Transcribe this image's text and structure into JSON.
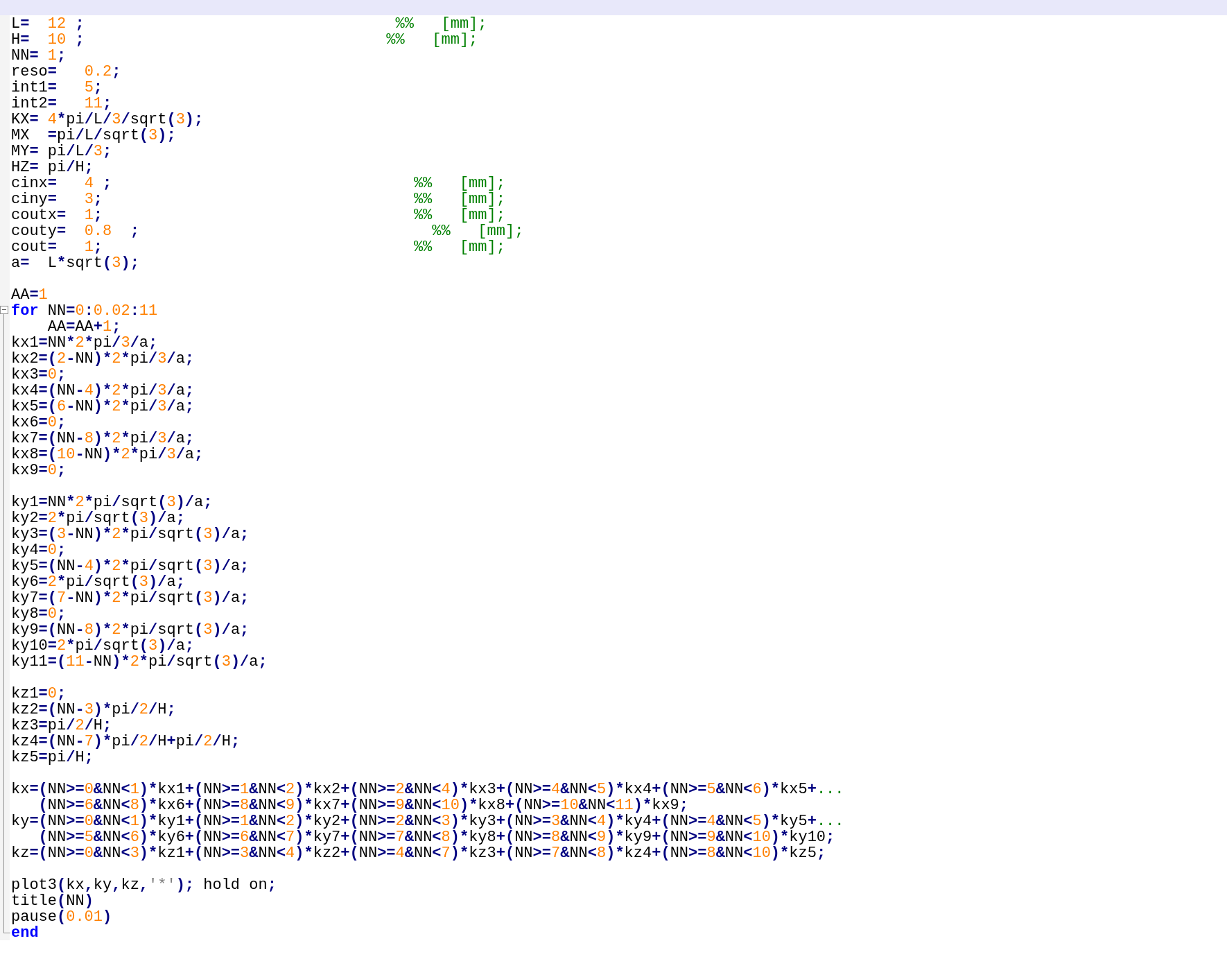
{
  "editor": {
    "lines": [
      {
        "tokens": [
          {
            "kind": "code",
            "text": "L=  "
          },
          {
            "kind": "number",
            "text": "12"
          },
          {
            "kind": "code",
            "text": " ;"
          },
          {
            "kind": "comment",
            "text": "                                  %%   [mm];"
          }
        ]
      },
      {
        "tokens": [
          {
            "kind": "code",
            "text": "H=  "
          },
          {
            "kind": "number",
            "text": "10"
          },
          {
            "kind": "code",
            "text": " ;"
          },
          {
            "kind": "comment",
            "text": "                                 %%   [mm];"
          }
        ]
      },
      {
        "tokens": [
          {
            "kind": "code",
            "text": "NN= "
          },
          {
            "kind": "number",
            "text": "1"
          },
          {
            "kind": "code",
            "text": ";"
          }
        ]
      },
      {
        "tokens": [
          {
            "kind": "code",
            "text": "reso=   "
          },
          {
            "kind": "number",
            "text": "0.2"
          },
          {
            "kind": "code",
            "text": ";"
          }
        ]
      },
      {
        "tokens": [
          {
            "kind": "code",
            "text": "int1=   "
          },
          {
            "kind": "number",
            "text": "5"
          },
          {
            "kind": "code",
            "text": ";"
          }
        ]
      },
      {
        "tokens": [
          {
            "kind": "code",
            "text": "int2=   "
          },
          {
            "kind": "number",
            "text": "11"
          },
          {
            "kind": "code",
            "text": ";"
          }
        ]
      },
      {
        "tokens": [
          {
            "kind": "code",
            "text": "KX= "
          },
          {
            "kind": "number",
            "text": "4"
          },
          {
            "kind": "code",
            "text": "*pi/L/"
          },
          {
            "kind": "number",
            "text": "3"
          },
          {
            "kind": "code",
            "text": "/sqrt("
          },
          {
            "kind": "number",
            "text": "3"
          },
          {
            "kind": "code",
            "text": ");"
          }
        ]
      },
      {
        "tokens": [
          {
            "kind": "code",
            "text": "MX  =pi/L/sqrt("
          },
          {
            "kind": "number",
            "text": "3"
          },
          {
            "kind": "code",
            "text": ");"
          }
        ]
      },
      {
        "tokens": [
          {
            "kind": "code",
            "text": "MY= pi/L/"
          },
          {
            "kind": "number",
            "text": "3"
          },
          {
            "kind": "code",
            "text": ";"
          }
        ]
      },
      {
        "tokens": [
          {
            "kind": "code",
            "text": "HZ= pi/H;"
          }
        ]
      },
      {
        "tokens": [
          {
            "kind": "code",
            "text": "cinx=   "
          },
          {
            "kind": "number",
            "text": "4"
          },
          {
            "kind": "code",
            "text": " ;"
          },
          {
            "kind": "comment",
            "text": "                                 %%   [mm];"
          }
        ]
      },
      {
        "tokens": [
          {
            "kind": "code",
            "text": "ciny=   "
          },
          {
            "kind": "number",
            "text": "3"
          },
          {
            "kind": "code",
            "text": ";"
          },
          {
            "kind": "comment",
            "text": "                                  %%   [mm];"
          }
        ]
      },
      {
        "tokens": [
          {
            "kind": "code",
            "text": "coutx=  "
          },
          {
            "kind": "number",
            "text": "1"
          },
          {
            "kind": "code",
            "text": ";"
          },
          {
            "kind": "comment",
            "text": "                                  %%   [mm];"
          }
        ]
      },
      {
        "tokens": [
          {
            "kind": "code",
            "text": "couty=  "
          },
          {
            "kind": "number",
            "text": "0.8"
          },
          {
            "kind": "code",
            "text": "  ;"
          },
          {
            "kind": "comment",
            "text": "                                %%   [mm];"
          }
        ]
      },
      {
        "tokens": [
          {
            "kind": "code",
            "text": "cout=   "
          },
          {
            "kind": "number",
            "text": "1"
          },
          {
            "kind": "code",
            "text": ";"
          },
          {
            "kind": "comment",
            "text": "                                  %%   [mm];"
          }
        ]
      },
      {
        "tokens": [
          {
            "kind": "code",
            "text": "a=  L*sqrt("
          },
          {
            "kind": "number",
            "text": "3"
          },
          {
            "kind": "code",
            "text": ");"
          }
        ]
      },
      {
        "kind": "blank"
      },
      {
        "tokens": [
          {
            "kind": "code",
            "text": "AA="
          },
          {
            "kind": "number",
            "text": "1"
          }
        ]
      },
      {
        "kind": "fold_start",
        "tokens": [
          {
            "kind": "keyword",
            "text": "for"
          },
          {
            "kind": "code",
            "text": " NN="
          },
          {
            "kind": "number",
            "text": "0"
          },
          {
            "kind": "code",
            "text": ":"
          },
          {
            "kind": "number",
            "text": "0.02"
          },
          {
            "kind": "code",
            "text": ":"
          },
          {
            "kind": "number",
            "text": "11"
          }
        ]
      },
      {
        "tokens": [
          {
            "kind": "code",
            "text": "    AA=AA+"
          },
          {
            "kind": "number",
            "text": "1"
          },
          {
            "kind": "code",
            "text": ";"
          }
        ]
      },
      {
        "tokens": [
          {
            "kind": "code",
            "text": "kx1=NN*"
          },
          {
            "kind": "number",
            "text": "2"
          },
          {
            "kind": "code",
            "text": "*pi/"
          },
          {
            "kind": "number",
            "text": "3"
          },
          {
            "kind": "code",
            "text": "/a;"
          }
        ]
      },
      {
        "tokens": [
          {
            "kind": "code",
            "text": "kx2=("
          },
          {
            "kind": "number",
            "text": "2"
          },
          {
            "kind": "code",
            "text": "-NN)*"
          },
          {
            "kind": "number",
            "text": "2"
          },
          {
            "kind": "code",
            "text": "*pi/"
          },
          {
            "kind": "number",
            "text": "3"
          },
          {
            "kind": "code",
            "text": "/a;"
          }
        ]
      },
      {
        "tokens": [
          {
            "kind": "code",
            "text": "kx3="
          },
          {
            "kind": "number",
            "text": "0"
          },
          {
            "kind": "code",
            "text": ";"
          }
        ]
      },
      {
        "tokens": [
          {
            "kind": "code",
            "text": "kx4=(NN-"
          },
          {
            "kind": "number",
            "text": "4"
          },
          {
            "kind": "code",
            "text": ")*"
          },
          {
            "kind": "number",
            "text": "2"
          },
          {
            "kind": "code",
            "text": "*pi/"
          },
          {
            "kind": "number",
            "text": "3"
          },
          {
            "kind": "code",
            "text": "/a;"
          }
        ]
      },
      {
        "tokens": [
          {
            "kind": "code",
            "text": "kx5=("
          },
          {
            "kind": "number",
            "text": "6"
          },
          {
            "kind": "code",
            "text": "-NN)*"
          },
          {
            "kind": "number",
            "text": "2"
          },
          {
            "kind": "code",
            "text": "*pi/"
          },
          {
            "kind": "number",
            "text": "3"
          },
          {
            "kind": "code",
            "text": "/a;"
          }
        ]
      },
      {
        "tokens": [
          {
            "kind": "code",
            "text": "kx6="
          },
          {
            "kind": "number",
            "text": "0"
          },
          {
            "kind": "code",
            "text": ";"
          }
        ]
      },
      {
        "tokens": [
          {
            "kind": "code",
            "text": "kx7=(NN-"
          },
          {
            "kind": "number",
            "text": "8"
          },
          {
            "kind": "code",
            "text": ")*"
          },
          {
            "kind": "number",
            "text": "2"
          },
          {
            "kind": "code",
            "text": "*pi/"
          },
          {
            "kind": "number",
            "text": "3"
          },
          {
            "kind": "code",
            "text": "/a;"
          }
        ]
      },
      {
        "tokens": [
          {
            "kind": "code",
            "text": "kx8=("
          },
          {
            "kind": "number",
            "text": "10"
          },
          {
            "kind": "code",
            "text": "-NN)*"
          },
          {
            "kind": "number",
            "text": "2"
          },
          {
            "kind": "code",
            "text": "*pi/"
          },
          {
            "kind": "number",
            "text": "3"
          },
          {
            "kind": "code",
            "text": "/a;"
          }
        ]
      },
      {
        "tokens": [
          {
            "kind": "code",
            "text": "kx9="
          },
          {
            "kind": "number",
            "text": "0"
          },
          {
            "kind": "code",
            "text": ";"
          }
        ]
      },
      {
        "kind": "blank"
      },
      {
        "tokens": [
          {
            "kind": "code",
            "text": "ky1=NN*"
          },
          {
            "kind": "number",
            "text": "2"
          },
          {
            "kind": "code",
            "text": "*pi/sqrt("
          },
          {
            "kind": "number",
            "text": "3"
          },
          {
            "kind": "code",
            "text": ")/a;"
          }
        ]
      },
      {
        "tokens": [
          {
            "kind": "code",
            "text": "ky2="
          },
          {
            "kind": "number",
            "text": "2"
          },
          {
            "kind": "code",
            "text": "*pi/sqrt("
          },
          {
            "kind": "number",
            "text": "3"
          },
          {
            "kind": "code",
            "text": ")/a;"
          }
        ]
      },
      {
        "tokens": [
          {
            "kind": "code",
            "text": "ky3=("
          },
          {
            "kind": "number",
            "text": "3"
          },
          {
            "kind": "code",
            "text": "-NN)*"
          },
          {
            "kind": "number",
            "text": "2"
          },
          {
            "kind": "code",
            "text": "*pi/sqrt("
          },
          {
            "kind": "number",
            "text": "3"
          },
          {
            "kind": "code",
            "text": ")/a;"
          }
        ]
      },
      {
        "tokens": [
          {
            "kind": "code",
            "text": "ky4="
          },
          {
            "kind": "number",
            "text": "0"
          },
          {
            "kind": "code",
            "text": ";"
          }
        ]
      },
      {
        "tokens": [
          {
            "kind": "code",
            "text": "ky5=(NN-"
          },
          {
            "kind": "number",
            "text": "4"
          },
          {
            "kind": "code",
            "text": ")*"
          },
          {
            "kind": "number",
            "text": "2"
          },
          {
            "kind": "code",
            "text": "*pi/sqrt("
          },
          {
            "kind": "number",
            "text": "3"
          },
          {
            "kind": "code",
            "text": ")/a;"
          }
        ]
      },
      {
        "tokens": [
          {
            "kind": "code",
            "text": "ky6="
          },
          {
            "kind": "number",
            "text": "2"
          },
          {
            "kind": "code",
            "text": "*pi/sqrt("
          },
          {
            "kind": "number",
            "text": "3"
          },
          {
            "kind": "code",
            "text": ")/a;"
          }
        ]
      },
      {
        "tokens": [
          {
            "kind": "code",
            "text": "ky7=("
          },
          {
            "kind": "number",
            "text": "7"
          },
          {
            "kind": "code",
            "text": "-NN)*"
          },
          {
            "kind": "number",
            "text": "2"
          },
          {
            "kind": "code",
            "text": "*pi/sqrt("
          },
          {
            "kind": "number",
            "text": "3"
          },
          {
            "kind": "code",
            "text": ")/a;"
          }
        ]
      },
      {
        "tokens": [
          {
            "kind": "code",
            "text": "ky8="
          },
          {
            "kind": "number",
            "text": "0"
          },
          {
            "kind": "code",
            "text": ";"
          }
        ]
      },
      {
        "tokens": [
          {
            "kind": "code",
            "text": "ky9=(NN-"
          },
          {
            "kind": "number",
            "text": "8"
          },
          {
            "kind": "code",
            "text": ")*"
          },
          {
            "kind": "number",
            "text": "2"
          },
          {
            "kind": "code",
            "text": "*pi/sqrt("
          },
          {
            "kind": "number",
            "text": "3"
          },
          {
            "kind": "code",
            "text": ")/a;"
          }
        ]
      },
      {
        "tokens": [
          {
            "kind": "code",
            "text": "ky10="
          },
          {
            "kind": "number",
            "text": "2"
          },
          {
            "kind": "code",
            "text": "*pi/sqrt("
          },
          {
            "kind": "number",
            "text": "3"
          },
          {
            "kind": "code",
            "text": ")/a;"
          }
        ]
      },
      {
        "tokens": [
          {
            "kind": "code",
            "text": "ky11=("
          },
          {
            "kind": "number",
            "text": "11"
          },
          {
            "kind": "code",
            "text": "-NN)*"
          },
          {
            "kind": "number",
            "text": "2"
          },
          {
            "kind": "code",
            "text": "*pi/sqrt("
          },
          {
            "kind": "number",
            "text": "3"
          },
          {
            "kind": "code",
            "text": ")/a;"
          }
        ]
      },
      {
        "kind": "blank"
      },
      {
        "tokens": [
          {
            "kind": "code",
            "text": "kz1="
          },
          {
            "kind": "number",
            "text": "0"
          },
          {
            "kind": "code",
            "text": ";"
          }
        ]
      },
      {
        "tokens": [
          {
            "kind": "code",
            "text": "kz2=(NN-"
          },
          {
            "kind": "number",
            "text": "3"
          },
          {
            "kind": "code",
            "text": ")*pi/"
          },
          {
            "kind": "number",
            "text": "2"
          },
          {
            "kind": "code",
            "text": "/H;"
          }
        ]
      },
      {
        "tokens": [
          {
            "kind": "code",
            "text": "kz3=pi/"
          },
          {
            "kind": "number",
            "text": "2"
          },
          {
            "kind": "code",
            "text": "/H;"
          }
        ]
      },
      {
        "tokens": [
          {
            "kind": "code",
            "text": "kz4=(NN-"
          },
          {
            "kind": "number",
            "text": "7"
          },
          {
            "kind": "code",
            "text": ")*pi/"
          },
          {
            "kind": "number",
            "text": "2"
          },
          {
            "kind": "code",
            "text": "/H+pi/"
          },
          {
            "kind": "number",
            "text": "2"
          },
          {
            "kind": "code",
            "text": "/H;"
          }
        ]
      },
      {
        "tokens": [
          {
            "kind": "code",
            "text": "kz5=pi/H;"
          }
        ]
      },
      {
        "kind": "blank"
      },
      {
        "tokens": [
          {
            "kind": "code",
            "text": "kx=(NN>="
          },
          {
            "kind": "number",
            "text": "0"
          },
          {
            "kind": "code",
            "text": "&NN<"
          },
          {
            "kind": "number",
            "text": "1"
          },
          {
            "kind": "code",
            "text": ")*kx1+(NN>="
          },
          {
            "kind": "number",
            "text": "1"
          },
          {
            "kind": "code",
            "text": "&NN<"
          },
          {
            "kind": "number",
            "text": "2"
          },
          {
            "kind": "code",
            "text": ")*kx2+(NN>="
          },
          {
            "kind": "number",
            "text": "2"
          },
          {
            "kind": "code",
            "text": "&NN<"
          },
          {
            "kind": "number",
            "text": "4"
          },
          {
            "kind": "code",
            "text": ")*kx3+(NN>="
          },
          {
            "kind": "number",
            "text": "4"
          },
          {
            "kind": "code",
            "text": "&NN<"
          },
          {
            "kind": "number",
            "text": "5"
          },
          {
            "kind": "code",
            "text": ")*kx4+(NN>="
          },
          {
            "kind": "number",
            "text": "5"
          },
          {
            "kind": "code",
            "text": "&NN<"
          },
          {
            "kind": "number",
            "text": "6"
          },
          {
            "kind": "code",
            "text": ")*kx5+"
          },
          {
            "kind": "comment",
            "text": "..."
          }
        ]
      },
      {
        "tokens": [
          {
            "kind": "code",
            "text": "   (NN>="
          },
          {
            "kind": "number",
            "text": "6"
          },
          {
            "kind": "code",
            "text": "&NN<"
          },
          {
            "kind": "number",
            "text": "8"
          },
          {
            "kind": "code",
            "text": ")*kx6+(NN>="
          },
          {
            "kind": "number",
            "text": "8"
          },
          {
            "kind": "code",
            "text": "&NN<"
          },
          {
            "kind": "number",
            "text": "9"
          },
          {
            "kind": "code",
            "text": ")*kx7+(NN>="
          },
          {
            "kind": "number",
            "text": "9"
          },
          {
            "kind": "code",
            "text": "&NN<"
          },
          {
            "kind": "number",
            "text": "10"
          },
          {
            "kind": "code",
            "text": ")*kx8+(NN>="
          },
          {
            "kind": "number",
            "text": "10"
          },
          {
            "kind": "code",
            "text": "&NN<"
          },
          {
            "kind": "number",
            "text": "11"
          },
          {
            "kind": "code",
            "text": ")*kx9;"
          }
        ]
      },
      {
        "tokens": [
          {
            "kind": "code",
            "text": "ky=(NN>="
          },
          {
            "kind": "number",
            "text": "0"
          },
          {
            "kind": "code",
            "text": "&NN<"
          },
          {
            "kind": "number",
            "text": "1"
          },
          {
            "kind": "code",
            "text": ")*ky1+(NN>="
          },
          {
            "kind": "number",
            "text": "1"
          },
          {
            "kind": "code",
            "text": "&NN<"
          },
          {
            "kind": "number",
            "text": "2"
          },
          {
            "kind": "code",
            "text": ")*ky2+(NN>="
          },
          {
            "kind": "number",
            "text": "2"
          },
          {
            "kind": "code",
            "text": "&NN<"
          },
          {
            "kind": "number",
            "text": "3"
          },
          {
            "kind": "code",
            "text": ")*ky3+(NN>="
          },
          {
            "kind": "number",
            "text": "3"
          },
          {
            "kind": "code",
            "text": "&NN<"
          },
          {
            "kind": "number",
            "text": "4"
          },
          {
            "kind": "code",
            "text": ")*ky4+(NN>="
          },
          {
            "kind": "number",
            "text": "4"
          },
          {
            "kind": "code",
            "text": "&NN<"
          },
          {
            "kind": "number",
            "text": "5"
          },
          {
            "kind": "code",
            "text": ")*ky5+"
          },
          {
            "kind": "comment",
            "text": "..."
          }
        ]
      },
      {
        "tokens": [
          {
            "kind": "code",
            "text": "   (NN>="
          },
          {
            "kind": "number",
            "text": "5"
          },
          {
            "kind": "code",
            "text": "&NN<"
          },
          {
            "kind": "number",
            "text": "6"
          },
          {
            "kind": "code",
            "text": ")*ky6+(NN>="
          },
          {
            "kind": "number",
            "text": "6"
          },
          {
            "kind": "code",
            "text": "&NN<"
          },
          {
            "kind": "number",
            "text": "7"
          },
          {
            "kind": "code",
            "text": ")*ky7+(NN>="
          },
          {
            "kind": "number",
            "text": "7"
          },
          {
            "kind": "code",
            "text": "&NN<"
          },
          {
            "kind": "number",
            "text": "8"
          },
          {
            "kind": "code",
            "text": ")*ky8+(NN>="
          },
          {
            "kind": "number",
            "text": "8"
          },
          {
            "kind": "code",
            "text": "&NN<"
          },
          {
            "kind": "number",
            "text": "9"
          },
          {
            "kind": "code",
            "text": ")*ky9+(NN>="
          },
          {
            "kind": "number",
            "text": "9"
          },
          {
            "kind": "code",
            "text": "&NN<"
          },
          {
            "kind": "number",
            "text": "10"
          },
          {
            "kind": "code",
            "text": ")*ky10;"
          }
        ]
      },
      {
        "tokens": [
          {
            "kind": "code",
            "text": "kz=(NN>="
          },
          {
            "kind": "number",
            "text": "0"
          },
          {
            "kind": "code",
            "text": "&NN<"
          },
          {
            "kind": "number",
            "text": "3"
          },
          {
            "kind": "code",
            "text": ")*kz1+(NN>="
          },
          {
            "kind": "number",
            "text": "3"
          },
          {
            "kind": "code",
            "text": "&NN<"
          },
          {
            "kind": "number",
            "text": "4"
          },
          {
            "kind": "code",
            "text": ")*kz2+(NN>="
          },
          {
            "kind": "number",
            "text": "4"
          },
          {
            "kind": "code",
            "text": "&NN<"
          },
          {
            "kind": "number",
            "text": "7"
          },
          {
            "kind": "code",
            "text": ")*kz3+(NN>="
          },
          {
            "kind": "number",
            "text": "7"
          },
          {
            "kind": "code",
            "text": "&NN<"
          },
          {
            "kind": "number",
            "text": "8"
          },
          {
            "kind": "code",
            "text": ")*kz4+(NN>="
          },
          {
            "kind": "number",
            "text": "8"
          },
          {
            "kind": "code",
            "text": "&NN<"
          },
          {
            "kind": "number",
            "text": "10"
          },
          {
            "kind": "code",
            "text": ")*kz5;"
          }
        ]
      },
      {
        "kind": "blank"
      },
      {
        "tokens": [
          {
            "kind": "code",
            "text": "plot3(kx,ky,kz,"
          },
          {
            "kind": "string",
            "text": "'*'"
          },
          {
            "kind": "code",
            "text": "); hold on;"
          }
        ]
      },
      {
        "tokens": [
          {
            "kind": "code",
            "text": "title(NN)"
          }
        ]
      },
      {
        "tokens": [
          {
            "kind": "code",
            "text": "pause("
          },
          {
            "kind": "number",
            "text": "0.01"
          },
          {
            "kind": "code",
            "text": ")"
          }
        ]
      },
      {
        "kind": "fold_end",
        "tokens": [
          {
            "kind": "keyword",
            "text": "end"
          }
        ]
      }
    ]
  }
}
